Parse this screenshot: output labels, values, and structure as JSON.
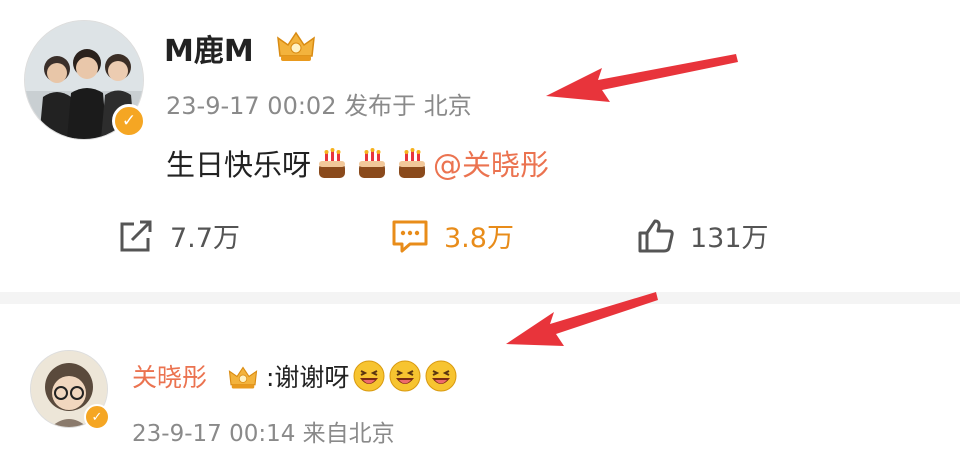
{
  "post": {
    "username": "M鹿M",
    "meta_text": "23-9-17 00:02 发布于 北京",
    "text": "生日快乐呀",
    "mention": "@关晓彤",
    "actions": {
      "repost_count": "7.7万",
      "comment_count": "3.8万",
      "like_count": "131万"
    }
  },
  "reply": {
    "username": "关晓彤",
    "text": ":谢谢呀",
    "meta_text": "23-9-17 00:14 来自北京"
  },
  "colors": {
    "accent_orange": "#eb7350",
    "comment_orange": "#e88c1a",
    "verified_gold": "#f5a623",
    "arrow_red": "#e8343b"
  },
  "icons": [
    "repost-icon",
    "comment-icon",
    "like-icon",
    "vip-crown-icon",
    "verified-badge-icon",
    "birthday-cake-icon",
    "laughing-face-icon"
  ]
}
